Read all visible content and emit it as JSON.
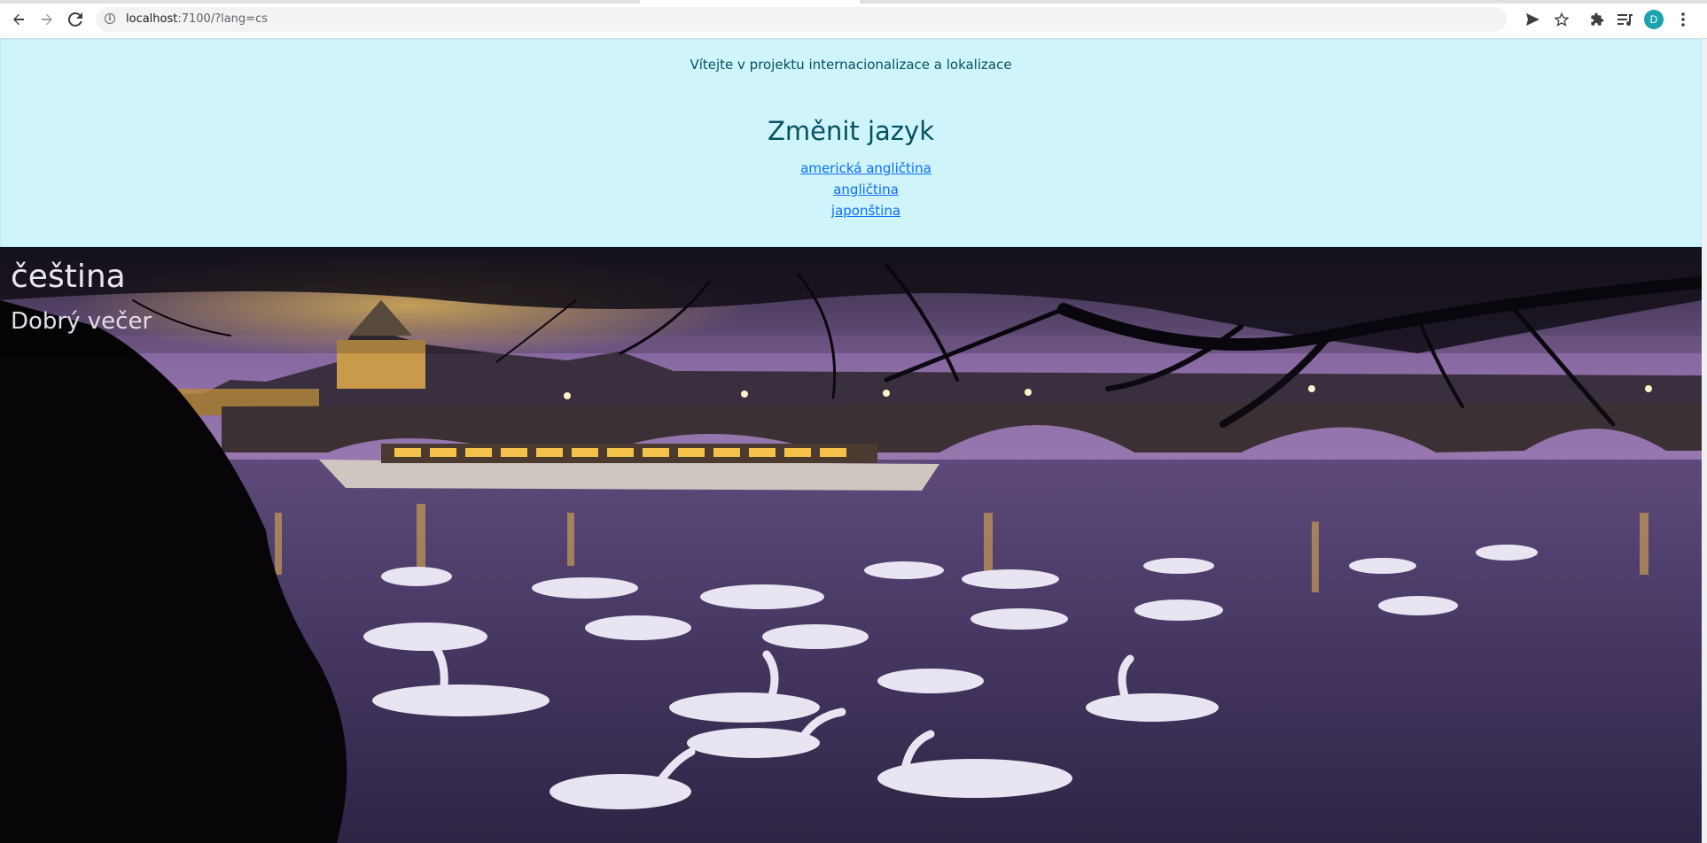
{
  "browser": {
    "url_host": "localhost",
    "url_rest": ":7100/?lang=cs",
    "profile_initial": "D",
    "icons": {
      "back": "arrow-left-icon",
      "forward": "arrow-right-icon",
      "reload": "reload-icon",
      "site_info": "info-icon",
      "send": "send-icon",
      "bookmark": "star-icon",
      "extensions": "puzzle-icon",
      "media": "media-queue-icon",
      "menu": "kebab-menu-icon"
    }
  },
  "header": {
    "welcome": "Vítejte v projektu internacionalizace a lokalizace",
    "change_language_title": "Změnit jazyk",
    "languages": [
      {
        "label": "americká angličtina"
      },
      {
        "label": "angličtina"
      },
      {
        "label": "japonština"
      }
    ],
    "colors": {
      "background": "#cff4fc",
      "text": "#055160",
      "link": "#0d6efd"
    }
  },
  "hero": {
    "current_language": "čeština",
    "greeting": "Dobrý večer"
  }
}
